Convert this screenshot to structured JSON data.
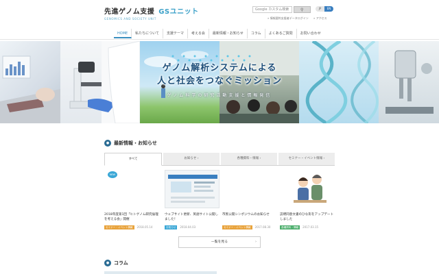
{
  "site": {
    "logo_main": "先進ゲノム支援",
    "logo_accent": "GSユニット",
    "logo_sub": "GENOMICS AND SOCIETY UNIT"
  },
  "search": {
    "placeholder": "Google カスタム検索",
    "button_icon": "search-icon"
  },
  "language": {
    "ja": "JP",
    "en": "EN"
  },
  "sub_links": [
    "» 情報要約支援者データログイン",
    "» アクセス"
  ],
  "nav": [
    {
      "label": "HOME",
      "active": true
    },
    {
      "label": "私たちについて"
    },
    {
      "label": "支援テーマ"
    },
    {
      "label": "考える会"
    },
    {
      "label": "最新情報・お知らせ"
    },
    {
      "label": "コラム"
    },
    {
      "label": "よくあるご質問"
    },
    {
      "label": "お問い合わせ"
    }
  ],
  "hero": {
    "line1": "ゲノム解析システムによる",
    "line2": "人と社会をつなぐミッション",
    "sub": "ゲノム科学の研究活動支援と情報発信"
  },
  "news": {
    "title": "最新情報・お知らせ",
    "tabs": [
      "すべて",
      "お知らせ ›",
      "各種資料・情報 ›",
      "セミナー・イベント情報 ›"
    ],
    "items": [
      {
        "badge": "NEW",
        "title": "2018年度第1回「ヒトゲノム研究倫理を考える会」開催",
        "category": "セミナー・イベント情報",
        "cat_color": "#e8a23a",
        "date": "2018.05.14"
      },
      {
        "title": "ウェブサイト更新、英語サイト公開しました！",
        "category": "お知らせ",
        "cat_color": "#3aa7d6",
        "date": "2018.04.03"
      },
      {
        "title": "市民公開シンポジウムのお知らせ",
        "category": "セミナー・イベント情報",
        "cat_color": "#e8a23a",
        "date": "2017.08.30"
      },
      {
        "title": "説明同意文書のひな形をアップデートしました",
        "category": "各種資料・情報",
        "cat_color": "#4cae6c",
        "date": "2017.03.15"
      }
    ],
    "more_label": "一覧を見る"
  },
  "column": {
    "title": "コラム"
  }
}
